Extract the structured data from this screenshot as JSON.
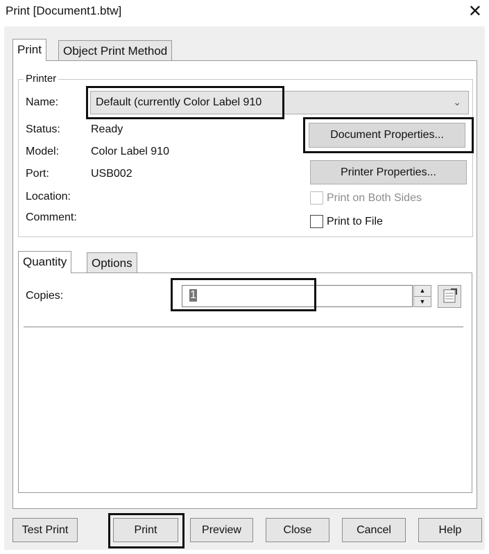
{
  "window": {
    "title": "Print [Document1.btw]",
    "close_glyph": "✕"
  },
  "tabs": {
    "print": "Print",
    "object_print_method": "Object Print Method"
  },
  "printer": {
    "group_label": "Printer",
    "name_label": "Name:",
    "name_value": "Default (currently Color Label 910",
    "status_label": "Status:",
    "status_value": "Ready",
    "model_label": "Model:",
    "model_value": "Color Label 910",
    "port_label": "Port:",
    "port_value": "USB002",
    "location_label": "Location:",
    "comment_label": "Comment:",
    "document_properties": "Document Properties...",
    "printer_properties": "Printer Properties...",
    "print_both_sides": "Print on Both Sides",
    "print_both_sides_checked": false,
    "print_to_file": "Print to File",
    "print_to_file_checked": false
  },
  "lower_tabs": {
    "quantity": "Quantity",
    "options": "Options"
  },
  "quantity": {
    "copies_label": "Copies:",
    "copies_value": "1"
  },
  "footer": {
    "test_print": "Test Print",
    "print": "Print",
    "preview": "Preview",
    "close": "Close",
    "cancel": "Cancel",
    "help": "Help"
  }
}
